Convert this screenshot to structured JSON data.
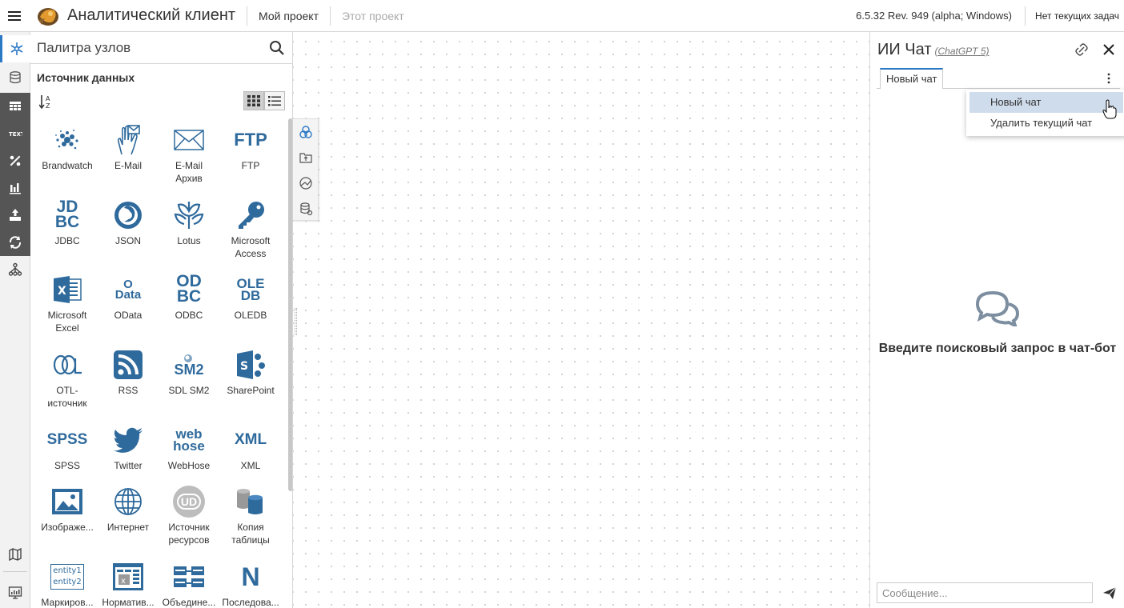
{
  "topbar": {
    "title": "Аналитический клиент",
    "my_project": "Мой проект",
    "this_project": "Этот проект",
    "version": "6.5.32 Rev. 949 (alpha; Windows)",
    "tasks": "Нет текущих задач"
  },
  "rail": {
    "icons": [
      "nodes-icon",
      "database-icon",
      "table-icon",
      "text-icon",
      "percent-icon",
      "bar-chart-icon",
      "export-icon",
      "refresh-icon",
      "hierarchy-icon",
      "map-icon",
      "monitor-icon"
    ]
  },
  "palette": {
    "search_placeholder": "Палитра узлов",
    "section_title": "Источник данных",
    "nodes": [
      {
        "label": "Brandwatch",
        "icon": "brandwatch-icon"
      },
      {
        "label": "E-Mail",
        "icon": "email-hand-icon"
      },
      {
        "label": "E-Mail\nАрхив",
        "icon": "envelope-icon"
      },
      {
        "label": "FTP",
        "icon": "ftp-icon",
        "glyph": "FTP"
      },
      {
        "label": "JDBC",
        "icon": "jdbc-icon",
        "glyph": "JD\nBC"
      },
      {
        "label": "JSON",
        "icon": "json-icon"
      },
      {
        "label": "Lotus",
        "icon": "lotus-icon"
      },
      {
        "label": "Microsoft\nAccess",
        "icon": "key-icon"
      },
      {
        "label": "Microsoft\nExcel",
        "icon": "excel-icon"
      },
      {
        "label": "OData",
        "icon": "odata-icon",
        "glyph": "O\nData"
      },
      {
        "label": "ODBC",
        "icon": "odbc-icon",
        "glyph": "OD\nBC"
      },
      {
        "label": "OLEDB",
        "icon": "oledb-icon",
        "glyph": "OLE\nDB"
      },
      {
        "label": "OTL-\nисточник",
        "icon": "otl-icon"
      },
      {
        "label": "RSS",
        "icon": "rss-icon"
      },
      {
        "label": "SDL SM2",
        "icon": "sm2-icon",
        "glyph": "SM2"
      },
      {
        "label": "SharePoint",
        "icon": "sharepoint-icon"
      },
      {
        "label": "SPSS",
        "icon": "spss-icon",
        "glyph": "SPSS"
      },
      {
        "label": "Twitter",
        "icon": "twitter-icon"
      },
      {
        "label": "WebHose",
        "icon": "webhose-icon",
        "glyph": "web\nhose"
      },
      {
        "label": "XML",
        "icon": "xml-icon",
        "glyph": "XML"
      },
      {
        "label": "Изображе...",
        "icon": "image-icon"
      },
      {
        "label": "Интернет",
        "icon": "globe-icon"
      },
      {
        "label": "Источник\nресурсов",
        "icon": "resource-icon",
        "glyph": "UD"
      },
      {
        "label": "Копия\nтаблицы",
        "icon": "table-copy-icon"
      },
      {
        "label": "Маркиров...",
        "icon": "entity-icon",
        "glyph": "entity1\nentity2"
      },
      {
        "label": "Норматив...",
        "icon": "normative-icon"
      },
      {
        "label": "Объедине...",
        "icon": "merge-icon"
      },
      {
        "label": "Последова...",
        "icon": "sequence-icon",
        "glyph": "N"
      }
    ]
  },
  "chat": {
    "title": "ИИ Чат",
    "model": "(ChatGPT 5)",
    "tab": "Новый чат",
    "menu": [
      "Новый чат",
      "Удалить текущий чат"
    ],
    "empty_text": "Введите поисковый запрос в чат-бот",
    "input_placeholder": "Сообщение..."
  },
  "colors": {
    "accent": "#2b78c5",
    "icon_blue": "#2f6a9c",
    "menu_highlight": "#cfdcec"
  }
}
